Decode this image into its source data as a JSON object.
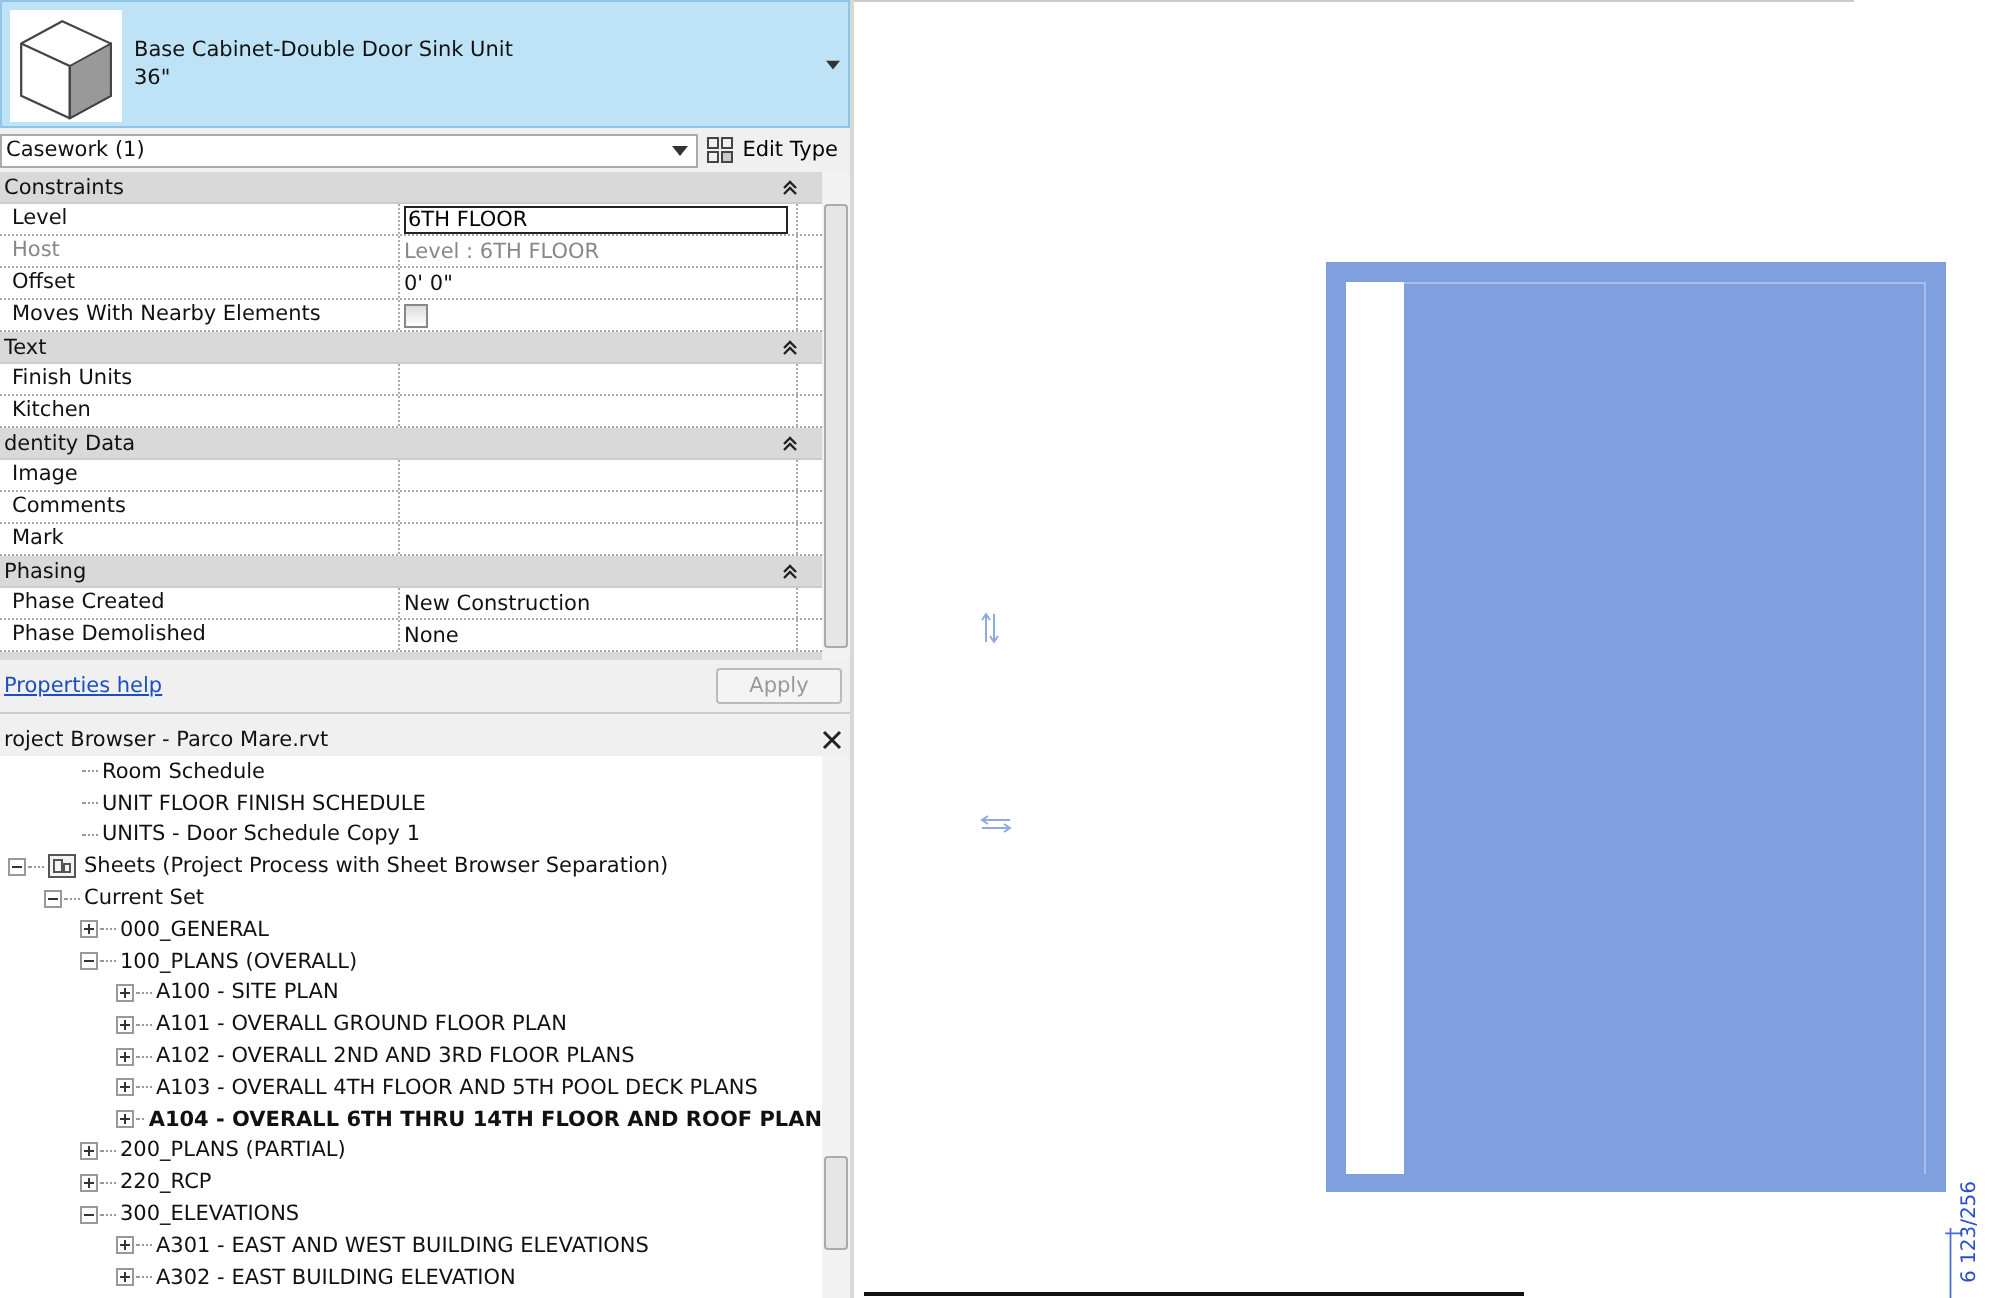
{
  "type_selector": {
    "name": "Base Cabinet-Double Door Sink Unit",
    "size": "36\""
  },
  "filter": {
    "value": "Casework (1)",
    "edit_type": "Edit Type"
  },
  "properties": [
    {
      "kind": "group",
      "label": "Constraints",
      "expanded": true
    },
    {
      "kind": "text",
      "label": "Level",
      "value": "6TH FLOOR",
      "editing": true,
      "disabled": false
    },
    {
      "kind": "text",
      "label": "Host",
      "value": "Level : 6TH FLOOR",
      "disabled": true
    },
    {
      "kind": "text",
      "label": "Offset",
      "value": "0'  0\"",
      "disabled": false
    },
    {
      "kind": "check",
      "label": "Moves With Nearby Elements",
      "checked": false,
      "disabled": false
    },
    {
      "kind": "group",
      "label": "Text",
      "expanded": true
    },
    {
      "kind": "text",
      "label": "Finish Units",
      "disabled": false
    },
    {
      "kind": "text",
      "label": "Kitchen",
      "disabled": false
    },
    {
      "kind": "group",
      "label": "dentity Data",
      "expanded": true
    },
    {
      "kind": "text",
      "label": "Image",
      "disabled": false
    },
    {
      "kind": "text",
      "label": "Comments",
      "disabled": false
    },
    {
      "kind": "text",
      "label": "Mark",
      "disabled": false
    },
    {
      "kind": "group",
      "label": "Phasing",
      "expanded": true
    },
    {
      "kind": "text",
      "label": "Phase Created",
      "value": "New Construction",
      "disabled": false
    },
    {
      "kind": "text",
      "label": "Phase Demolished",
      "value": "None",
      "disabled": false
    }
  ],
  "help_link": "Properties help",
  "apply_button": {
    "label": "Apply",
    "disabled": true
  },
  "browser": {
    "title": "roject Browser - Parco Mare.rvt",
    "tree": [
      {
        "label": "Room Schedule",
        "kind": "leaf"
      },
      {
        "label": "UNIT FLOOR FINISH SCHEDULE",
        "kind": "leaf"
      },
      {
        "label": "UNITS - Door Schedule Copy 1",
        "kind": "leaf"
      },
      {
        "label": "Sheets (Project Process with Sheet Browser Separation)",
        "kind": "sheets",
        "expanded": true,
        "children": [
          {
            "label": "Current Set",
            "expanded": true,
            "children": [
              {
                "label": "000_GENERAL",
                "expanded": false
              },
              {
                "label": "100_PLANS (OVERALL)",
                "expanded": true,
                "children": [
                  {
                    "label": "A100 - SITE PLAN",
                    "expanded": false,
                    "current": false
                  },
                  {
                    "label": "A101 - OVERALL GROUND FLOOR PLAN",
                    "expanded": false,
                    "current": false
                  },
                  {
                    "label": "A102 - OVERALL 2ND AND 3RD FLOOR PLANS",
                    "expanded": false,
                    "current": false
                  },
                  {
                    "label": "A103 - OVERALL 4TH FLOOR AND 5TH POOL DECK PLANS",
                    "expanded": false,
                    "current": false
                  },
                  {
                    "label": "A104 - OVERALL 6TH THRU 14TH FLOOR AND ROOF PLAN",
                    "expanded": false,
                    "current": true
                  }
                ]
              },
              {
                "label": "200_PLANS (PARTIAL)",
                "expanded": false
              },
              {
                "label": "220_RCP",
                "expanded": false
              },
              {
                "label": "300_ELEVATIONS",
                "expanded": true,
                "children": [
                  {
                    "label": "A301 - EAST AND WEST BUILDING ELEVATIONS",
                    "expanded": false,
                    "current": false
                  },
                  {
                    "label": "A302 - EAST BUILDING ELEVATION",
                    "expanded": false,
                    "current": false
                  }
                ]
              }
            ]
          }
        ]
      }
    ]
  },
  "canvas": {
    "dimension": "6 123/256"
  }
}
